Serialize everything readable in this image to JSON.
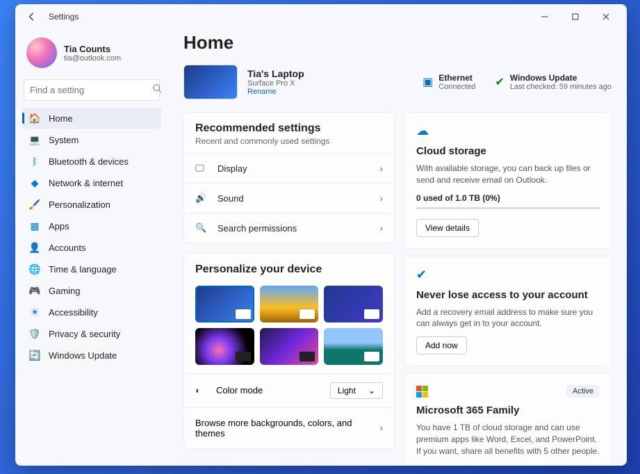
{
  "window": {
    "title": "Settings"
  },
  "profile": {
    "name": "Tia Counts",
    "email": "tia@outlook.com"
  },
  "search": {
    "placeholder": "Find a setting"
  },
  "nav": {
    "home": "Home",
    "system": "System",
    "bluetooth": "Bluetooth & devices",
    "network": "Network & internet",
    "personalization": "Personalization",
    "apps": "Apps",
    "accounts": "Accounts",
    "time": "Time & language",
    "gaming": "Gaming",
    "accessibility": "Accessibility",
    "privacy": "Privacy & security",
    "update": "Windows Update"
  },
  "page": {
    "title": "Home",
    "device": {
      "name": "Tia's Laptop",
      "model": "Surface Pro X",
      "rename": "Rename"
    },
    "status": {
      "ethernet": {
        "title": "Ethernet",
        "sub": "Connected"
      },
      "update": {
        "title": "Windows Update",
        "sub": "Last checked: 59 minutes ago"
      }
    },
    "recommended": {
      "title": "Recommended settings",
      "sub": "Recent and commonly used settings",
      "display": "Display",
      "sound": "Sound",
      "search_perm": "Search permissions"
    },
    "personalize": {
      "title": "Personalize your device",
      "color_mode": "Color mode",
      "color_value": "Light",
      "browse": "Browse more backgrounds, colors, and themes"
    },
    "cloud": {
      "title": "Cloud storage",
      "desc": "With available storage, you can back up files or send and receive email on Outlook.",
      "used": "0 used of 1.0 TB (0%)",
      "button": "View details"
    },
    "recovery": {
      "title": "Never lose access to your account",
      "desc": "Add a recovery email address to make sure you can always get in to your account.",
      "button": "Add now"
    },
    "m365": {
      "badge": "Active",
      "title": "Microsoft 365 Family",
      "desc": "You have 1 TB of cloud storage and can use premium apps like Word, Excel, and PowerPoint. If you want, share all benefits with 5 other people."
    }
  }
}
